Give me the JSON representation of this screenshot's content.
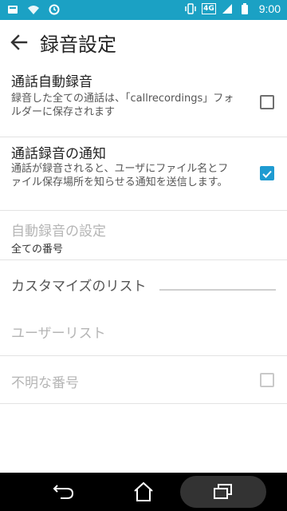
{
  "status_bar": {
    "time": "9:00",
    "network": "4G",
    "icons": [
      "notification-icon",
      "wifi-icon",
      "sync-icon",
      "vibrate-icon",
      "signal-icon",
      "battery-icon"
    ]
  },
  "app_bar": {
    "title": "録音設定",
    "back_icon": "arrow-left-icon"
  },
  "settings": {
    "auto_record": {
      "title": "通話自動録音",
      "summary": "録音した全ての通話は、「callrecordings」フォルダーに保存されます",
      "checked": false
    },
    "record_notify": {
      "title": "通話録音の通知",
      "summary": "通話が録音されると、ユーザにファイル名とファイル保存場所を知らせる通知を送信します。",
      "checked": true
    },
    "auto_record_settings": {
      "title": "自動録音の設定",
      "summary": "全ての番号"
    },
    "customize_section": {
      "label": "カスタマイズのリスト"
    },
    "user_list": {
      "title": "ユーザーリスト"
    },
    "unknown_number": {
      "title": "不明な番号",
      "checked": false
    }
  },
  "nav_bar": {
    "back_icon": "nav-back-icon",
    "home_icon": "nav-home-icon",
    "recent_icon": "nav-recent-apps-icon"
  }
}
